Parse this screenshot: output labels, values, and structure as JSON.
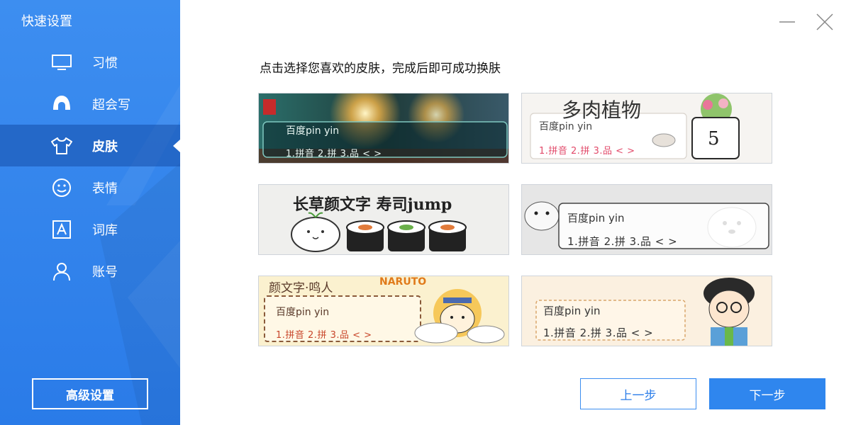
{
  "sidebar": {
    "title": "快速设置",
    "items": [
      {
        "label": "习惯",
        "icon": "monitor-icon"
      },
      {
        "label": "超会写",
        "icon": "pen-icon"
      },
      {
        "label": "皮肤",
        "icon": "shirt-icon",
        "active": true
      },
      {
        "label": "表情",
        "icon": "smiley-icon"
      },
      {
        "label": "词库",
        "icon": "letter-a-icon"
      },
      {
        "label": "账号",
        "icon": "user-icon"
      }
    ],
    "advanced_button": "高级设置"
  },
  "window": {
    "minimize": "—",
    "close": "✕"
  },
  "main": {
    "instruction": "点击选择您喜欢的皮肤，完成后即可成功换肤",
    "skins": [
      {
        "name": "sparkler",
        "pinyin": "百度pin yin",
        "candidates": "1.拼音 2.拼 3.品 < >"
      },
      {
        "name": "succulent",
        "banner": "多肉植物",
        "pinyin": "百度pin yin",
        "candidates": "1.拼音 2.拼 3.品 < >"
      },
      {
        "name": "sushi",
        "banner": "长草颜文字 寿司jump"
      },
      {
        "name": "husky",
        "pinyin": "百度pin yin",
        "candidates": "1.拼音 2.拼 3.品 < >"
      },
      {
        "name": "naruto",
        "banner": "颜文字·鸣人",
        "logo": "NARUTO",
        "pinyin": "百度pin yin",
        "candidates": "1.拼音 2.拼 3.品 < >"
      },
      {
        "name": "cartoon-boy",
        "pinyin": "百度pin yin",
        "candidates": "1.拼音 2.拼 3.品 < >"
      }
    ]
  },
  "footer": {
    "prev": "上一步",
    "next": "下一步"
  },
  "colors": {
    "accent": "#2f86ee",
    "sidebar": "#3d8ef0"
  }
}
